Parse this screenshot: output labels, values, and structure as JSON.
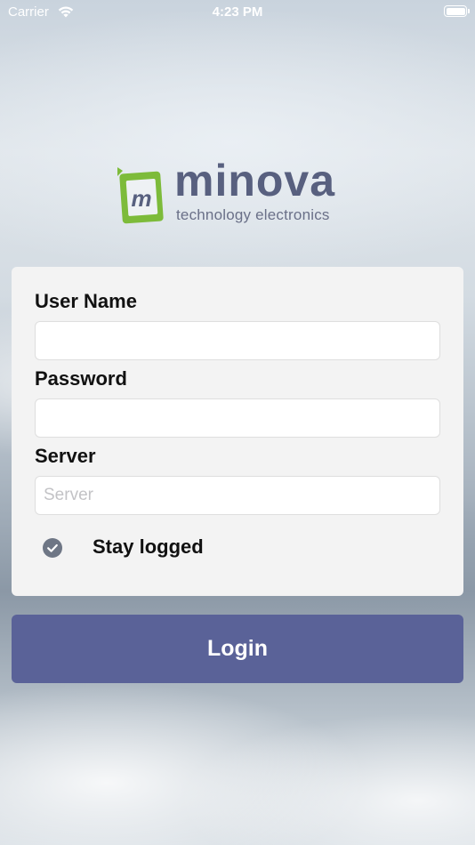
{
  "status_bar": {
    "carrier": "Carrier",
    "time": "4:23 PM"
  },
  "brand": {
    "name": "minova",
    "tagline": "technology electronics",
    "colors": {
      "logo_green": "#7dbb3a",
      "logo_text": "#58607f"
    }
  },
  "form": {
    "username": {
      "label": "User Name",
      "value": "",
      "placeholder": ""
    },
    "password": {
      "label": "Password",
      "value": "",
      "placeholder": ""
    },
    "server": {
      "label": "Server",
      "value": "",
      "placeholder": "Server"
    },
    "stay_logged": {
      "label": "Stay logged",
      "checked": true
    }
  },
  "actions": {
    "login_label": "Login",
    "login_color": "#5a6298"
  }
}
